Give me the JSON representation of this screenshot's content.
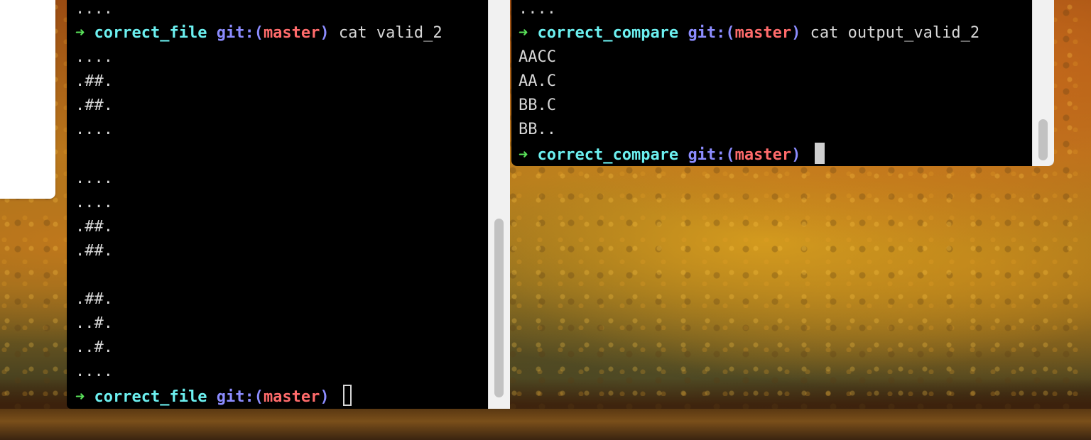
{
  "left_terminal": {
    "lines": [
      {
        "kind": "out",
        "text": "...."
      },
      {
        "kind": "prompt",
        "dir": "correct_file",
        "git": "git:(",
        "branch": "master",
        "git_close": ")",
        "cmd": "cat valid_2"
      },
      {
        "kind": "out",
        "text": "...."
      },
      {
        "kind": "out",
        "text": ".##."
      },
      {
        "kind": "out",
        "text": ".##."
      },
      {
        "kind": "out",
        "text": "...."
      },
      {
        "kind": "out",
        "text": ""
      },
      {
        "kind": "out",
        "text": "...."
      },
      {
        "kind": "out",
        "text": "...."
      },
      {
        "kind": "out",
        "text": ".##."
      },
      {
        "kind": "out",
        "text": ".##."
      },
      {
        "kind": "out",
        "text": ""
      },
      {
        "kind": "out",
        "text": ".##."
      },
      {
        "kind": "out",
        "text": "..#."
      },
      {
        "kind": "out",
        "text": "..#."
      },
      {
        "kind": "out",
        "text": "...."
      },
      {
        "kind": "prompt",
        "dir": "correct_file",
        "git": "git:(",
        "branch": "master",
        "git_close": ")",
        "cmd": "",
        "cursor": "outline"
      }
    ]
  },
  "right_terminal": {
    "lines": [
      {
        "kind": "out",
        "text": "...."
      },
      {
        "kind": "prompt",
        "dir": "correct_compare",
        "git": "git:(",
        "branch": "master",
        "git_close": ")",
        "cmd": "cat output_valid_2"
      },
      {
        "kind": "out",
        "text": "AACC"
      },
      {
        "kind": "out",
        "text": "AA.C"
      },
      {
        "kind": "out",
        "text": "BB.C"
      },
      {
        "kind": "out",
        "text": "BB.."
      },
      {
        "kind": "prompt",
        "dir": "correct_compare",
        "git": "git:(",
        "branch": "master",
        "git_close": ")",
        "cmd": "",
        "cursor": "block"
      }
    ]
  },
  "prompt_symbol": "➜",
  "colors": {
    "arrow": "#5ae35a",
    "dir": "#6cf0f0",
    "git": "#8c8cff",
    "branch": "#ff6b6b",
    "text": "#d7d7d7",
    "terminal_bg": "#000000"
  }
}
